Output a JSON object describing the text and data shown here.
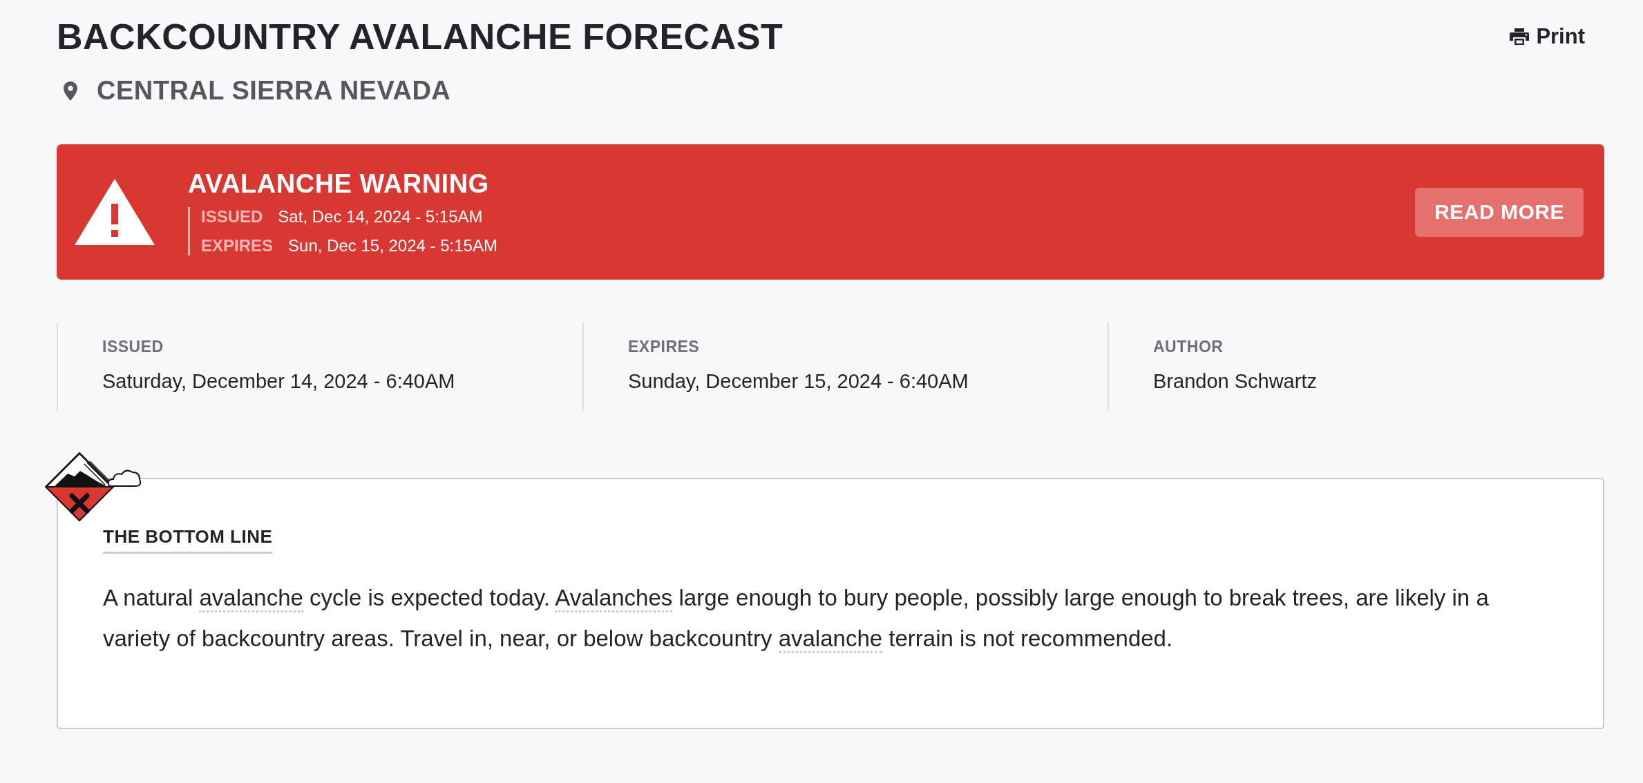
{
  "header": {
    "title": "BACKCOUNTRY AVALANCHE FORECAST",
    "print_label": "Print"
  },
  "zone": {
    "name": "CENTRAL SIERRA NEVADA"
  },
  "warning": {
    "title": "AVALANCHE WARNING",
    "lines": [
      {
        "label": "ISSUED",
        "value": "Sat, Dec 14, 2024 - 5:15AM"
      },
      {
        "label": "EXPIRES",
        "value": "Sun, Dec 15, 2024 - 5:15AM"
      }
    ],
    "button": "READ MORE"
  },
  "meta": [
    {
      "label": "ISSUED",
      "value": "Saturday, December 14, 2024 - 6:40AM"
    },
    {
      "label": "EXPIRES",
      "value": "Sunday, December 15, 2024 - 6:40AM"
    },
    {
      "label": "AUTHOR",
      "value": "Brandon Schwartz"
    }
  ],
  "bottom_line": {
    "heading": "THE BOTTOM LINE",
    "segments": [
      {
        "kind": "text",
        "text": "A natural "
      },
      {
        "kind": "term",
        "text": "avalanche"
      },
      {
        "kind": "text",
        "text": " cycle is expected today. "
      },
      {
        "kind": "term",
        "text": "Avalanches"
      },
      {
        "kind": "text",
        "text": " large enough to bury people, possibly large enough to break trees, are likely in a variety of backcountry areas. Travel in, near, or below backcountry "
      },
      {
        "kind": "term",
        "text": "avalanche"
      },
      {
        "kind": "text",
        "text": " terrain is not recommended."
      }
    ]
  }
}
